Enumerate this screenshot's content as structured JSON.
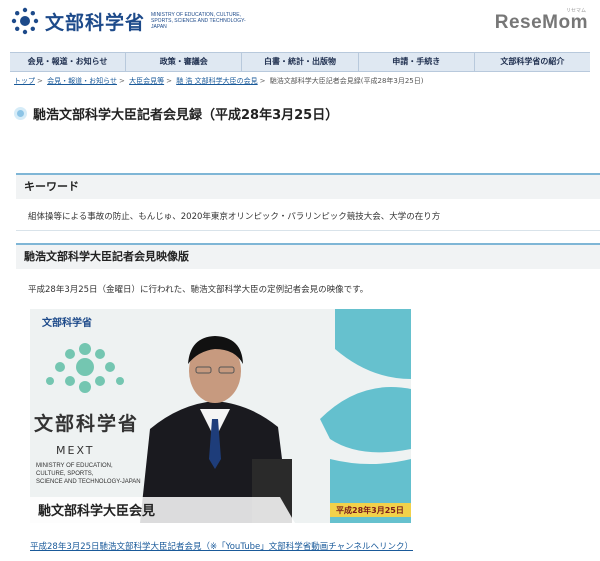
{
  "header": {
    "logo_jp": "文部科学省",
    "logo_en": "MINISTRY OF EDUCATION, CULTURE, SPORTS, SCIENCE AND TECHNOLOGY-JAPAN",
    "resemom": "ReseMom",
    "resemom_kana": "リセマム"
  },
  "nav": [
    "会見・報道・お知らせ",
    "政策・審議会",
    "白書・統計・出版物",
    "申請・手続き",
    "文部科学省の紹介"
  ],
  "breadcrumb": {
    "items": [
      "トップ",
      "会見・報道・お知らせ",
      "大臣会見等",
      "馳 浩 文部科学大臣の会見"
    ],
    "current": "馳浩文部科学大臣記者会見録(平成28年3月25日)"
  },
  "page_title": "馳浩文部科学大臣記者会見録（平成28年3月25日）",
  "keywords": {
    "heading": "キーワード",
    "text": "組体操等による事故の防止、もんじゅ、2020年東京オリンピック・パラリンピック競技大会、大学の在り方"
  },
  "video_section": {
    "heading": "馳浩文部科学大臣記者会見映像版",
    "desc": "平成28年3月25日（金曜日）に行われた、馳浩文部科学大臣の定例記者会見の映像です。",
    "video": {
      "logo_jp": "文部科学省",
      "big_jp": "文部科学省",
      "mext": "MEXT",
      "mext_sub": [
        "MINISTRY OF EDUCATION,",
        "CULTURE, SPORTS,",
        "SCIENCE AND TECHNOLOGY-JAPAN"
      ],
      "caption": "馳文部科学大臣会見",
      "date": "平成28年3月25日"
    },
    "link": "平成28年3月25日馳浩文部科学大臣記者会見（※「YouTube」文部科学省動画チャンネルへリンク）"
  }
}
